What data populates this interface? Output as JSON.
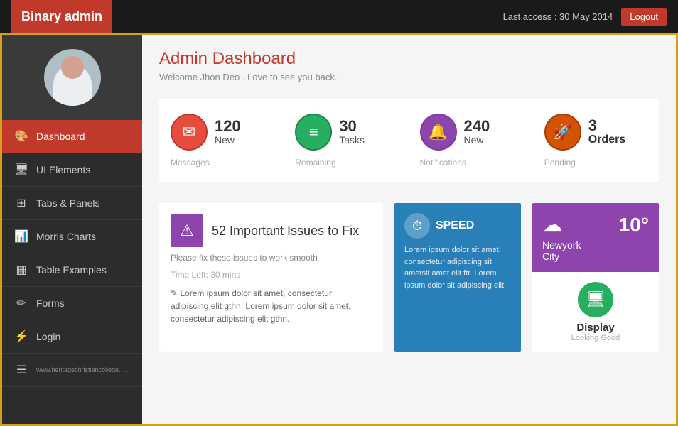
{
  "header": {
    "brand": "Binary admin",
    "last_access": "Last access : 30 May 2014",
    "logout_label": "Logout"
  },
  "sidebar": {
    "items": [
      {
        "id": "dashboard",
        "label": "Dashboard",
        "icon": "🎨",
        "active": true
      },
      {
        "id": "ui-elements",
        "label": "UI Elements",
        "icon": "🖥",
        "active": false
      },
      {
        "id": "tabs-panels",
        "label": "Tabs & Panels",
        "icon": "⊞",
        "active": false
      },
      {
        "id": "morris-charts",
        "label": "Morris Charts",
        "icon": "📊",
        "active": false
      },
      {
        "id": "table-examples",
        "label": "Table Examples",
        "icon": "⊟",
        "active": false
      },
      {
        "id": "forms",
        "label": "Forms",
        "icon": "✏",
        "active": false
      },
      {
        "id": "login",
        "label": "Login",
        "icon": "⚡",
        "active": false
      }
    ],
    "url": "www.heritagechristiancollege.com"
  },
  "content": {
    "title": "Admin Dashboard",
    "subtitle": "Welcome Jhon Deo . Love to see you back.",
    "stats": [
      {
        "id": "messages",
        "number": "120",
        "label": "New",
        "desc": "Messages",
        "icon": "✉",
        "color": "red"
      },
      {
        "id": "tasks",
        "number": "30",
        "label": "Tasks",
        "desc": "Remaining",
        "icon": "≡",
        "color": "green"
      },
      {
        "id": "notifications",
        "number": "240",
        "label": "New",
        "desc": "Notifications",
        "icon": "🔔",
        "color": "purple"
      },
      {
        "id": "orders",
        "number": "3",
        "label": "Orders",
        "desc": "Pending",
        "icon": "🚀",
        "color": "orange"
      }
    ],
    "issues": {
      "count": "52 Important Issues to Fix",
      "subtitle": "Please fix these issues to work smooth",
      "time_left": "Time Left: 30 mins",
      "body": "Lorem ipsum dolor sit amet, consectetur adipiscing elit gthn. Lorem ipsum dolor sit amet, consectetur adipiscing elit gthn."
    },
    "speed": {
      "title": "SPEED",
      "body": "Lorem ipsum dolor sit amet, consectetur adipiscing sit ametsit amet elit ftr. Lorem ipsum dolor sit adipiscing elit."
    },
    "weather": {
      "city_line1": "Newyork",
      "city_line2": "City",
      "temp": "10°"
    },
    "display": {
      "title": "Display",
      "sub": "Looking Good"
    }
  }
}
